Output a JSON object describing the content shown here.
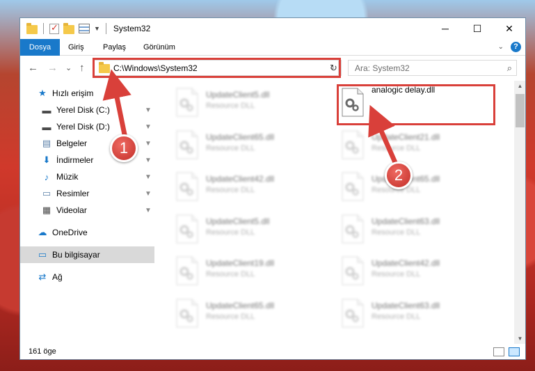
{
  "window": {
    "title": "System32",
    "minimize_glyph": "─",
    "maximize_glyph": "☐",
    "close_glyph": "✕"
  },
  "ribbon": {
    "tabs": [
      "Dosya",
      "Giriş",
      "Paylaş",
      "Görünüm"
    ],
    "help_glyph": "?",
    "collapse_glyph": "⌄"
  },
  "nav": {
    "back_glyph": "←",
    "forward_glyph": "→",
    "recent_glyph": "⌄",
    "up_glyph": "↑",
    "address": "C:\\Windows\\System32",
    "address_dropdown_glyph": "⌄",
    "refresh_glyph": "↻",
    "search_placeholder": "Ara: System32",
    "search_glyph": "⌕"
  },
  "sidebar": {
    "items": [
      {
        "label": "Hızlı erişim",
        "icon": "star-icon",
        "glyph": "★",
        "pinned": false,
        "color": "#1979ca"
      },
      {
        "label": "Yerel Disk (C:)",
        "icon": "drive-icon",
        "glyph": "▬",
        "pinned": true,
        "color": "#4a4a4a"
      },
      {
        "label": "Yerel Disk (D:)",
        "icon": "drive-icon",
        "glyph": "▬",
        "pinned": true,
        "color": "#4a4a4a"
      },
      {
        "label": "Belgeler",
        "icon": "documents-icon",
        "glyph": "▤",
        "pinned": true,
        "color": "#5a7fa8"
      },
      {
        "label": "İndirmeler",
        "icon": "download-icon",
        "glyph": "⬇",
        "pinned": true,
        "color": "#1979ca"
      },
      {
        "label": "Müzik",
        "icon": "music-icon",
        "glyph": "♪",
        "pinned": true,
        "color": "#1979ca"
      },
      {
        "label": "Resimler",
        "icon": "pictures-icon",
        "glyph": "▭",
        "pinned": true,
        "color": "#5a7fa8"
      },
      {
        "label": "Videolar",
        "icon": "video-icon",
        "glyph": "▦",
        "pinned": true,
        "color": "#4a4a4a"
      },
      {
        "label": "OneDrive",
        "icon": "cloud-icon",
        "glyph": "☁",
        "pinned": false,
        "color": "#1979ca"
      },
      {
        "label": "Bu bilgisayar",
        "icon": "computer-icon",
        "glyph": "▭",
        "pinned": false,
        "color": "#1979ca",
        "selected": true
      },
      {
        "label": "Ağ",
        "icon": "network-icon",
        "glyph": "⇄",
        "pinned": false,
        "color": "#1979ca"
      }
    ],
    "pin_glyph": "📌"
  },
  "files": {
    "left_column": [
      {
        "name": "UpdateClient5.dll",
        "type": "Resource DLL"
      },
      {
        "name": "UpdateClient65.dll",
        "type": "Resource DLL"
      },
      {
        "name": "UpdateClient42.dll",
        "type": "Resource DLL"
      },
      {
        "name": "UpdateClient5.dll",
        "type": "Resource DLL"
      },
      {
        "name": "UpdateClient19.dll",
        "type": "Resource DLL"
      },
      {
        "name": "UpdateClient65.dll",
        "type": "Resource DLL"
      }
    ],
    "right_column": [
      {
        "name": "analogic delay.dll",
        "type": "",
        "highlighted": true
      },
      {
        "name": "UpdateClient21.dll",
        "type": "Resource DLL"
      },
      {
        "name": "UpdateClient65.dll",
        "type": "Resource DLL"
      },
      {
        "name": "UpdateClient63.dll",
        "type": "Resource DLL"
      },
      {
        "name": "UpdateClient42.dll",
        "type": "Resource DLL"
      },
      {
        "name": "UpdateClient63.dll",
        "type": "Resource DLL"
      }
    ]
  },
  "status": {
    "item_count": "161 öge"
  },
  "annotations": {
    "step1": "1",
    "step2": "2",
    "color": "#d9403a"
  }
}
